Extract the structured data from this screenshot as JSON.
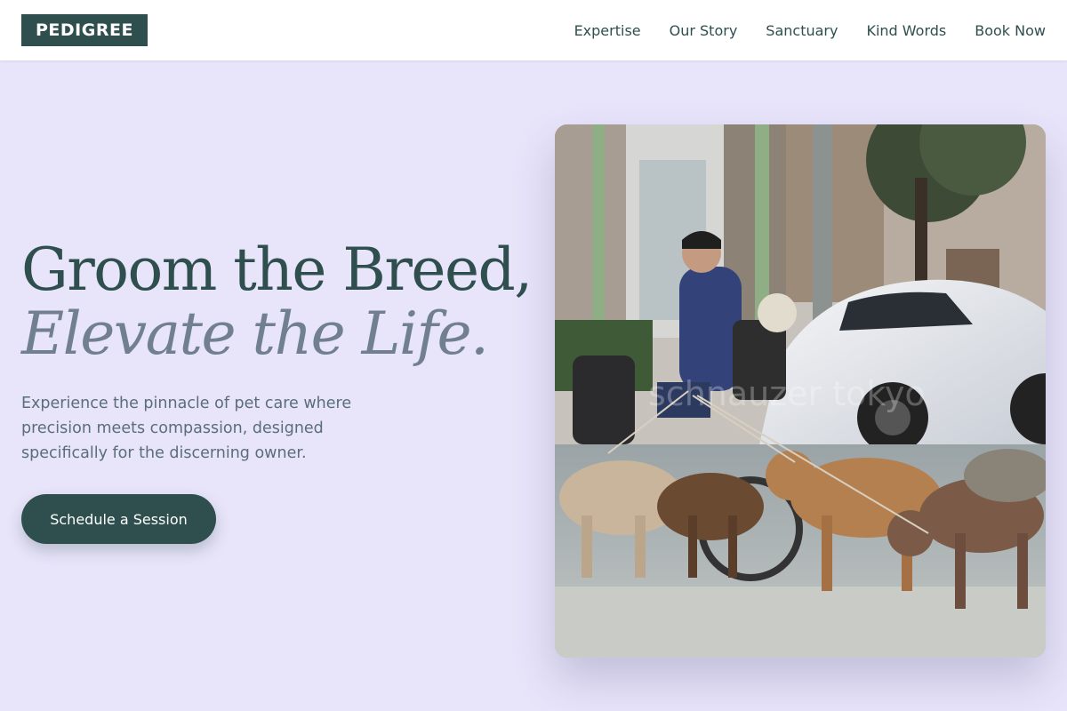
{
  "header": {
    "logo": "PEDIGREE",
    "nav": [
      {
        "label": "Expertise"
      },
      {
        "label": "Our Story"
      },
      {
        "label": "Sanctuary"
      },
      {
        "label": "Kind Words"
      },
      {
        "label": "Book Now"
      }
    ]
  },
  "hero": {
    "headline_line1": "Groom the Breed,",
    "headline_line2": "Elevate the Life.",
    "subtext": "Experience the pinnacle of pet care where precision meets compassion, designed specifically for the discerning owner.",
    "cta_label": "Schedule a Session",
    "image_watermark": "schnauzer tokyo"
  },
  "colors": {
    "primary": "#2f4f4f",
    "accent_gray": "#708090",
    "background": "#e8e4fa",
    "header_bg": "#ffffff"
  }
}
